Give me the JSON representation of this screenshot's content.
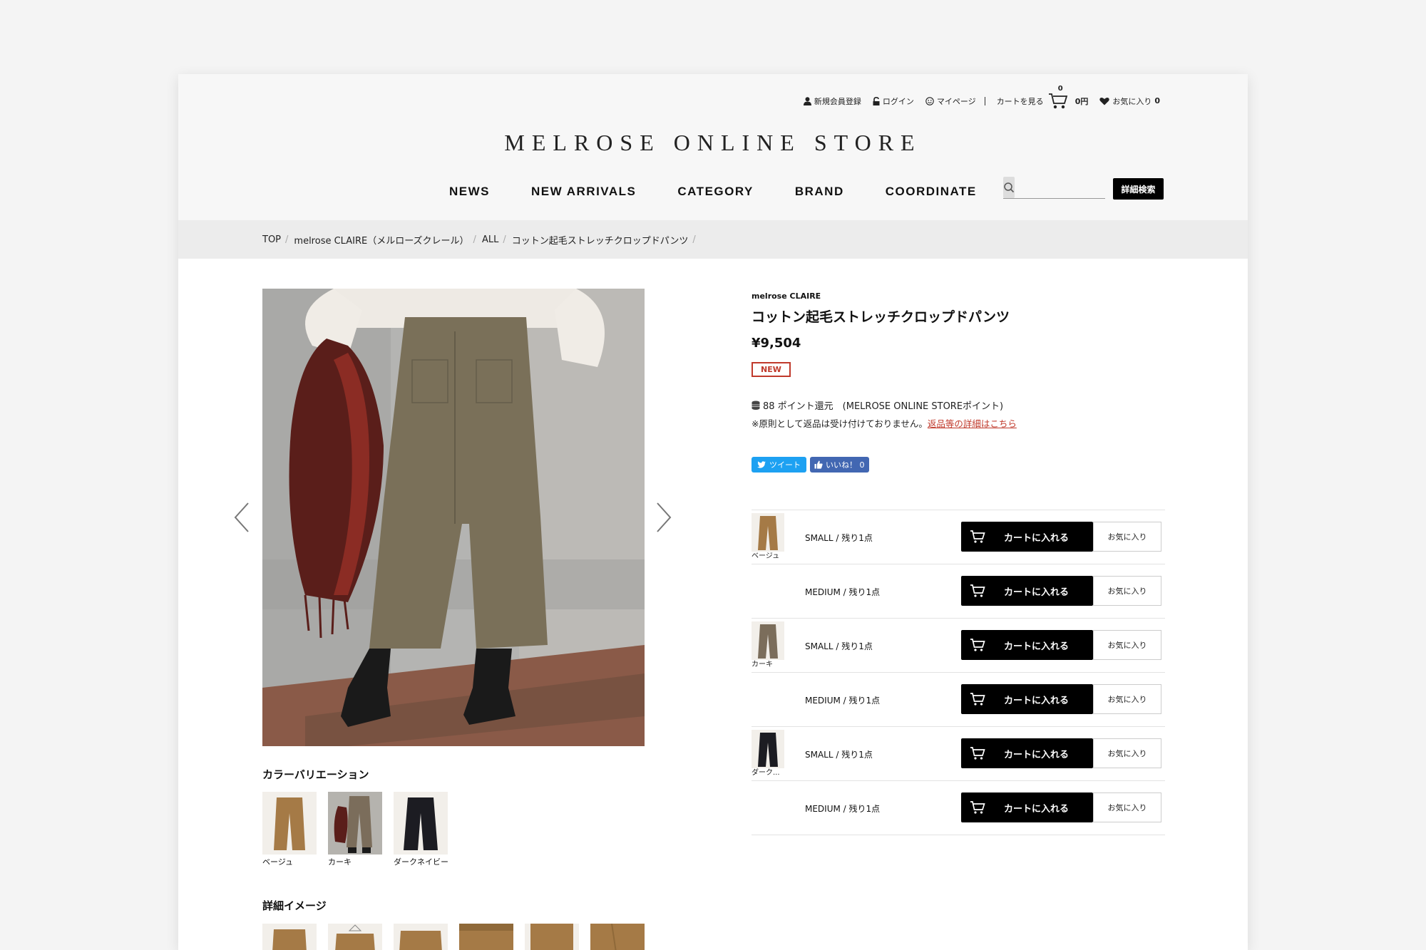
{
  "header": {
    "signup_label": "新規会員登録",
    "login_label": "ログイン",
    "mypage_label": "マイページ",
    "cart_label": "カートを見る",
    "cart_count": "0",
    "cart_total": "0円",
    "favorites_label": "お気に入り",
    "favorites_count": "0",
    "logo": "MELROSE ONLINE STORE",
    "nav": [
      "NEWS",
      "NEW ARRIVALS",
      "CATEGORY",
      "BRAND",
      "COORDINATE"
    ],
    "search_placeholder": "",
    "advanced_search_label": "詳細検索"
  },
  "breadcrumb": [
    "TOP",
    "melrose CLAIRE（メルローズクレール）",
    "ALL",
    "コットン起毛ストレッチクロップドパンツ"
  ],
  "gallery": {
    "color_variation_title": "カラーバリエーション",
    "swatches": [
      {
        "label": "ベージュ",
        "color": "#a57a46"
      },
      {
        "label": "カーキ",
        "color": "#7b6d5b"
      },
      {
        "label": "ダークネイビー",
        "color": "#1c1c22"
      }
    ],
    "detail_title": "詳細イメージ"
  },
  "product": {
    "brand": "melrose CLAIRE",
    "name": "コットン起毛ストレッチクロップドパンツ",
    "price": "¥9,504",
    "badge": "NEW",
    "points_text": "88 ポイント還元　(MELROSE ONLINE STOREポイント)",
    "return_note": "※原則として返品は受け付けておりません。",
    "return_link": "返品等の詳細はこちら",
    "tweet_label": "ツイート",
    "like_label": "いいね！ 0"
  },
  "stock": [
    {
      "color": "ベージュ",
      "swatch": "#a57a46",
      "size": "SMALL / 残り1点",
      "show_thumb": true
    },
    {
      "color": "",
      "swatch": "",
      "size": "MEDIUM / 残り1点",
      "show_thumb": false
    },
    {
      "color": "カーキ",
      "swatch": "#7b6d5b",
      "size": "SMALL / 残り1点",
      "show_thumb": true
    },
    {
      "color": "",
      "swatch": "",
      "size": "MEDIUM / 残り1点",
      "show_thumb": false
    },
    {
      "color": "ダーク...",
      "swatch": "#1c1c22",
      "size": "SMALL / 残り1点",
      "show_thumb": true
    },
    {
      "color": "",
      "swatch": "",
      "size": "MEDIUM / 残り1点",
      "show_thumb": false
    }
  ],
  "stock_buttons": {
    "cart": "カートに入れる",
    "favorite": "お気に入り"
  },
  "colors": {
    "accent_red": "#c0392b",
    "black": "#000000",
    "twitter": "#1da1f2",
    "facebook": "#4267b2"
  }
}
